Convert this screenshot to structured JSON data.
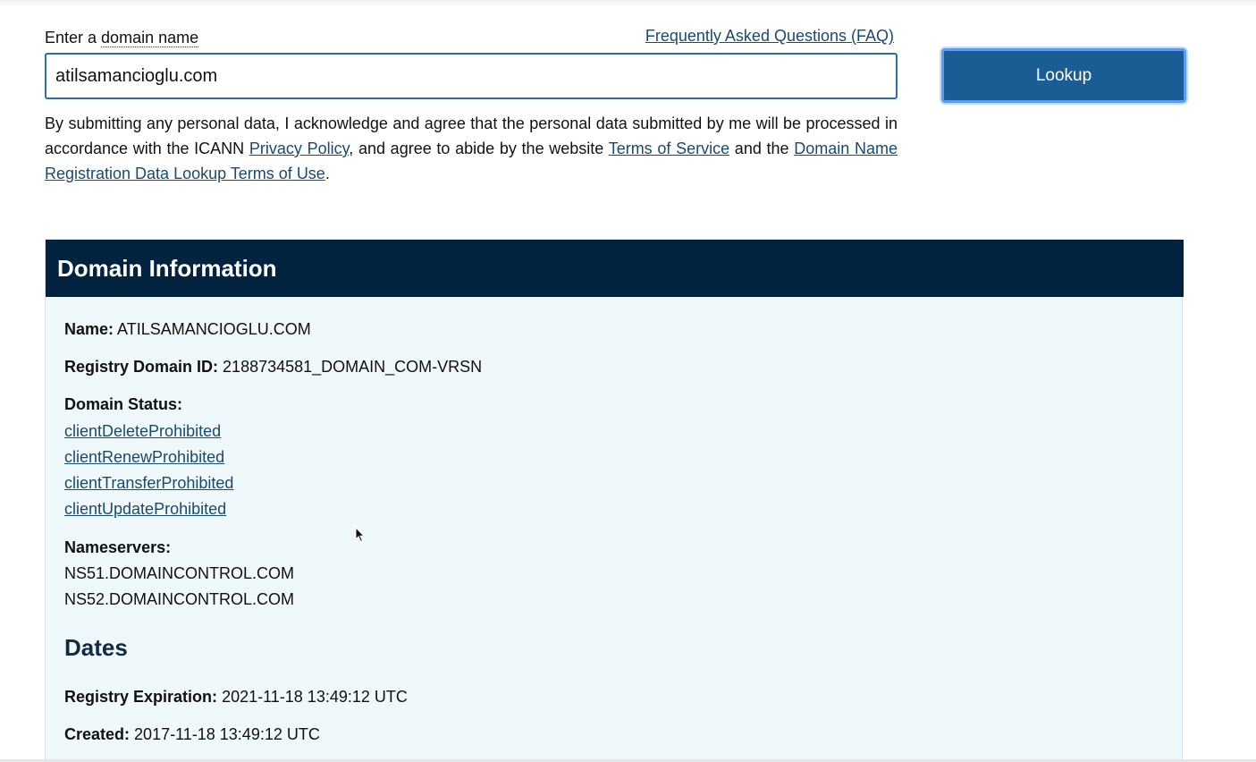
{
  "search": {
    "label_prefix": "Enter a ",
    "label_abbr": "domain name",
    "faq_link": "Frequently Asked Questions (FAQ)",
    "input_value": "atilsamancioglu.com",
    "lookup_button": "Lookup"
  },
  "disclaimer": {
    "text_1": "By submitting any personal data, I acknowledge and agree that the personal data submitted by me will be processed in accordance with the ICANN ",
    "privacy_link": "Privacy Policy",
    "text_2": ", and agree to abide by the website ",
    "terms_link": "Terms of Service",
    "text_3": " and the ",
    "lookup_terms_link": "Domain Name Registration Data Lookup Terms of Use",
    "text_4": "."
  },
  "domain_info": {
    "header": "Domain Information",
    "name_label": "Name:",
    "name_value": "ATILSAMANCIOGLU.COM",
    "registry_id_label": "Registry Domain ID:",
    "registry_id_value": "2188734581_DOMAIN_COM-VRSN",
    "status_label": "Domain Status:",
    "statuses": [
      "clientDeleteProhibited",
      "clientRenewProhibited",
      "clientTransferProhibited",
      "clientUpdateProhibited"
    ],
    "nameservers_label": "Nameservers:",
    "nameservers": [
      "NS51.DOMAINCONTROL.COM",
      "NS52.DOMAINCONTROL.COM"
    ]
  },
  "dates": {
    "title": "Dates",
    "expiration_label": "Registry Expiration:",
    "expiration_value": "2021-11-18 13:49:12 UTC",
    "created_label": "Created:",
    "created_value": "2017-11-18 13:49:12 UTC"
  },
  "icons": {
    "cursor": "mouse-pointer-icon"
  }
}
